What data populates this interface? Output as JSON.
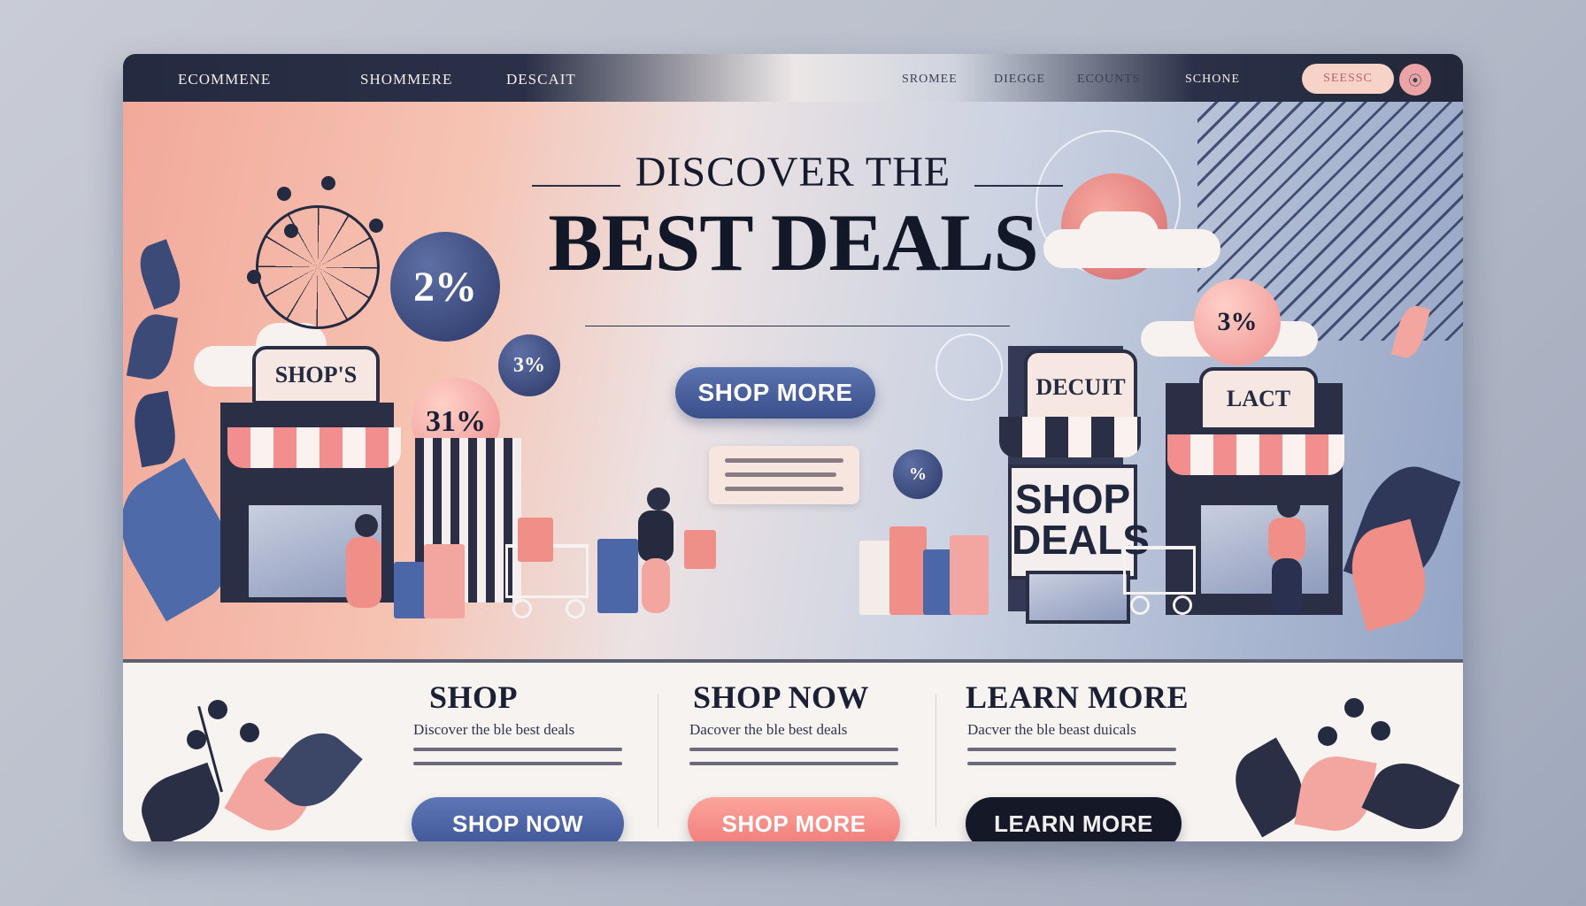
{
  "nav": {
    "brand": "ECOMMENE",
    "link_1": "SHOMMERE",
    "link_2": "DESCAIT",
    "link_3": "SROMEE",
    "link_4": "DIEGGE",
    "link_5": "ECOUNTS",
    "link_6": "SCHONE",
    "button_label": "SEESSC",
    "avatar_glyph": "⦿"
  },
  "hero": {
    "headline_small": "DISCOVER THE",
    "headline_big": "BEST DEALS",
    "cta_label": "SHOP MORE",
    "badges": {
      "badge_a": "2%",
      "badge_b": "3%",
      "badge_c": "31%",
      "badge_d": "3%",
      "badge_e": "%"
    },
    "store_left_sign": "SHOP'S",
    "store_mid_sign": "DECUIT",
    "store_tall_sign_line_1": "SHOP",
    "store_tall_sign_line_2": "DEALS",
    "store_right_sign": "LACT"
  },
  "columns": [
    {
      "title": "SHOP",
      "subtitle": "Discover the ble best deals",
      "button": "SHOP NOW"
    },
    {
      "title": "SHOP NOW",
      "subtitle": "Dacover the ble best deals",
      "button": "SHOP MORE"
    },
    {
      "title": "LEARN MORE",
      "subtitle": "Dacver the ble beast duicals",
      "button": "LEARN MORE"
    }
  ],
  "colors": {
    "navy": "#2a2f45",
    "coral": "#f07a78",
    "blue_button": "#3f5595",
    "dark_button": "#141827"
  }
}
